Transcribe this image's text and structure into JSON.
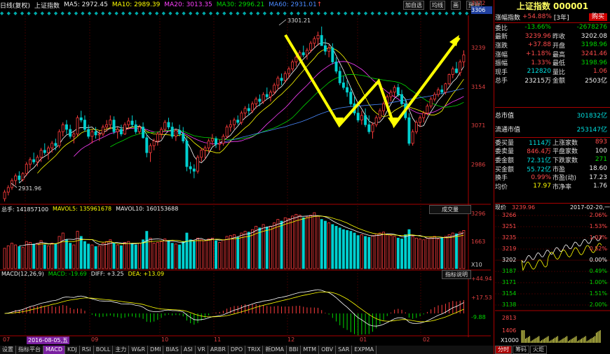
{
  "toolbar": {
    "period": "日线(复权)",
    "name": "上证指数",
    "ma5": "MA5: 2972.45",
    "ma10": "MA10: 2989.39",
    "ma20": "MA20: 3013.35",
    "ma30": "MA30: 2996.21",
    "ma60": "MA60: 2931.01",
    "btn_add": "加自选",
    "btn_ma": "均线",
    "btn_draw": "画",
    "btn_forecast": "预测"
  },
  "price_axis": [
    "3306",
    "3239",
    "3154",
    "3071",
    "2986"
  ],
  "price_axis_top": "3322",
  "annotations": {
    "high": "3301.21",
    "low": "2931.96"
  },
  "vol_bar": {
    "total": "总手: 141857100",
    "mavol5": "MAVOL5: 135961678",
    "mavol10": "MAVOL10: 160153688",
    "btn": "成交量",
    "axis_top": "3296",
    "axis_mid": "1663",
    "axis_unit": "X10"
  },
  "macd_bar": {
    "title": "MACD(12,26,9)",
    "macd": "MACD: -19.69",
    "diff": "DIFF: +3.25",
    "dea": "DEA: +13.09",
    "btn": "指标说明",
    "axis": [
      "+44.94",
      "+17.53",
      "-9.88"
    ]
  },
  "months": [
    "07",
    "08",
    "09",
    "10",
    "11",
    "12",
    "01",
    "02"
  ],
  "cursor_date": "2016-08-05,五",
  "bottom_tabs": [
    "设置",
    "指标平台",
    "MACD",
    "KDJ",
    "RSI",
    "BOLL",
    "主力",
    "W&R",
    "DMI",
    "BIAS",
    "ASI",
    "VR",
    "ARBR",
    "DPO",
    "TRIX",
    "新DMA",
    "BBI",
    "MTM",
    "OBV",
    "SAR",
    "EXPMA"
  ],
  "right": {
    "title": "上证指数 000001",
    "sub1": "涨幅指数",
    "sub2": "+54.88%",
    "sub3": "[3年]",
    "btn_buy": "购买",
    "rows": [
      [
        "委比",
        "-13.66%",
        "",
        "-2678276"
      ],
      [
        "最新",
        "3239.96",
        "昨收",
        "3202.08"
      ],
      [
        "涨跌",
        "+37.88",
        "开盘",
        "3198.96"
      ],
      [
        "涨幅",
        "+1.18%",
        "最高",
        "3241.46"
      ],
      [
        "振幅",
        "1.33%",
        "最低",
        "3198.96"
      ],
      [
        "现手",
        "212820",
        "量比",
        "1.06"
      ],
      [
        "总手",
        "23215万",
        "金额",
        "2503亿"
      ]
    ],
    "mktcap_k": "总市值",
    "mktcap_v": "301832亿",
    "float_k": "流通市值",
    "float_v": "253147亿",
    "rows2": [
      [
        "委买量",
        "1114万",
        "上涨家数",
        "893"
      ],
      [
        "委卖量",
        "846.4万",
        "平盘家数",
        "100"
      ],
      [
        "委金额",
        "72.31亿",
        "下跌家数",
        "271"
      ],
      [
        "买金额",
        "55.72亿",
        "市盈",
        "18.60"
      ],
      [
        "换手",
        "0.99%",
        "市盈(动)",
        "17.23"
      ],
      [
        "均价",
        "17.97",
        "市净率",
        "1.76"
      ]
    ],
    "intraday": {
      "label": "现价",
      "price": "3239.96",
      "date": "2017-02-20,一",
      "left_axis": [
        "3266",
        "3251",
        "3235",
        "3219",
        "3202",
        "3187",
        "3171",
        "3154",
        "3138"
      ],
      "right_axis": [
        "2.06%",
        "1.53%",
        "1.03%",
        "0.52%",
        "0.00%",
        "0.49%",
        "1.00%",
        "1.51%",
        "2.00%"
      ],
      "vol_axis": [
        "2813",
        "1406"
      ],
      "vol_unit": "X1000"
    },
    "tabs": [
      "分时",
      "筹码",
      "火炬"
    ]
  },
  "chart_data": {
    "type": "candlestick",
    "candles": [
      [
        2931,
        2950,
        2925,
        2945
      ],
      [
        2945,
        2960,
        2938,
        2955
      ],
      [
        2955,
        2975,
        2950,
        2970
      ],
      [
        2970,
        2985,
        2960,
        2980
      ],
      [
        2980,
        2990,
        2965,
        2972
      ],
      [
        2972,
        2988,
        2968,
        2985
      ],
      [
        2985,
        3010,
        2980,
        3005
      ],
      [
        3005,
        3020,
        2995,
        3015
      ],
      [
        3015,
        3030,
        3005,
        3010
      ],
      [
        3010,
        3025,
        3000,
        3020
      ],
      [
        3020,
        3040,
        3010,
        3035
      ],
      [
        3035,
        3050,
        3025,
        3030
      ],
      [
        3030,
        3045,
        3015,
        3040
      ],
      [
        3040,
        3055,
        3030,
        3050
      ],
      [
        3050,
        3060,
        3035,
        3045
      ],
      [
        3045,
        3080,
        3040,
        3075
      ],
      [
        3075,
        3095,
        3065,
        3090
      ],
      [
        3090,
        3100,
        3070,
        3080
      ],
      [
        3080,
        3090,
        3060,
        3065
      ],
      [
        3065,
        3075,
        3050,
        3070
      ],
      [
        3070,
        3110,
        3065,
        3105
      ],
      [
        3105,
        3120,
        3095,
        3100
      ],
      [
        3100,
        3110,
        3075,
        3080
      ],
      [
        3080,
        3090,
        3060,
        3065
      ],
      [
        3065,
        3080,
        3050,
        3075
      ],
      [
        3075,
        3085,
        3060,
        3068
      ],
      [
        3068,
        3078,
        3055,
        3070
      ],
      [
        3070,
        3090,
        3065,
        3085
      ],
      [
        3085,
        3100,
        3075,
        3090
      ],
      [
        3090,
        3110,
        3080,
        3100
      ],
      [
        3100,
        3108,
        3070,
        3075
      ],
      [
        3075,
        3085,
        3060,
        3080
      ],
      [
        3080,
        3090,
        3065,
        3070
      ],
      [
        3070,
        3095,
        3068,
        3090
      ],
      [
        3090,
        3105,
        3080,
        3098
      ],
      [
        3098,
        3110,
        3085,
        3090
      ],
      [
        3090,
        3100,
        3070,
        3075
      ],
      [
        3075,
        3090,
        3070,
        3085
      ],
      [
        3085,
        3095,
        3060,
        3062
      ],
      [
        3062,
        3070,
        3020,
        3030
      ],
      [
        3030,
        3050,
        3010,
        3045
      ],
      [
        3045,
        3060,
        3035,
        3055
      ],
      [
        3055,
        3075,
        3045,
        3070
      ],
      [
        3070,
        3085,
        3060,
        3080
      ],
      [
        3080,
        3100,
        3075,
        3095
      ],
      [
        3095,
        3105,
        3080,
        3085
      ],
      [
        3085,
        3095,
        3060,
        3065
      ],
      [
        3065,
        3080,
        3055,
        3078
      ],
      [
        3078,
        3090,
        3065,
        3070
      ],
      [
        3070,
        3085,
        3050,
        3055
      ],
      [
        3055,
        3065,
        2990,
        3000
      ],
      [
        3000,
        3010,
        2985,
        2995
      ],
      [
        2995,
        3005,
        2975,
        2990
      ],
      [
        2990,
        3025,
        2985,
        3020
      ],
      [
        3020,
        3040,
        3010,
        3035
      ],
      [
        3035,
        3045,
        3015,
        3040
      ],
      [
        3040,
        3060,
        3030,
        3055
      ],
      [
        3055,
        3070,
        3045,
        3060
      ],
      [
        3060,
        3065,
        3040,
        3048
      ],
      [
        3048,
        3058,
        3035,
        3050
      ],
      [
        3050,
        3070,
        3045,
        3065
      ],
      [
        3065,
        3090,
        3060,
        3085
      ],
      [
        3085,
        3100,
        3075,
        3090
      ],
      [
        3090,
        3105,
        3080,
        3100
      ],
      [
        3100,
        3110,
        3090,
        3095
      ],
      [
        3095,
        3120,
        3090,
        3115
      ],
      [
        3115,
        3130,
        3105,
        3125
      ],
      [
        3125,
        3135,
        3110,
        3120
      ],
      [
        3120,
        3140,
        3115,
        3135
      ],
      [
        3135,
        3150,
        3125,
        3145
      ],
      [
        3145,
        3155,
        3130,
        3140
      ],
      [
        3140,
        3160,
        3135,
        3155
      ],
      [
        3155,
        3170,
        3145,
        3150
      ],
      [
        3150,
        3165,
        3140,
        3160
      ],
      [
        3160,
        3180,
        3155,
        3175
      ],
      [
        3175,
        3195,
        3165,
        3190
      ],
      [
        3190,
        3200,
        3175,
        3185
      ],
      [
        3185,
        3205,
        3180,
        3200
      ],
      [
        3200,
        3215,
        3190,
        3210
      ],
      [
        3210,
        3230,
        3205,
        3225
      ],
      [
        3225,
        3240,
        3215,
        3235
      ],
      [
        3235,
        3250,
        3225,
        3245
      ],
      [
        3245,
        3260,
        3235,
        3240
      ],
      [
        3240,
        3255,
        3230,
        3250
      ],
      [
        3250,
        3270,
        3245,
        3265
      ],
      [
        3265,
        3280,
        3255,
        3275
      ],
      [
        3275,
        3290,
        3260,
        3282
      ],
      [
        3282,
        3301,
        3270,
        3260
      ],
      [
        3260,
        3275,
        3240,
        3248
      ],
      [
        3248,
        3262,
        3235,
        3255
      ],
      [
        3255,
        3265,
        3220,
        3225
      ],
      [
        3225,
        3235,
        3200,
        3205
      ],
      [
        3205,
        3215,
        3175,
        3180
      ],
      [
        3180,
        3195,
        3165,
        3170
      ],
      [
        3170,
        3185,
        3150,
        3160
      ],
      [
        3160,
        3170,
        3130,
        3135
      ],
      [
        3135,
        3150,
        3110,
        3115
      ],
      [
        3115,
        3130,
        3095,
        3100
      ],
      [
        3100,
        3120,
        3090,
        3110
      ],
      [
        3110,
        3125,
        3085,
        3090
      ],
      [
        3090,
        3110,
        3070,
        3075
      ],
      [
        3075,
        3095,
        3060,
        3090
      ],
      [
        3090,
        3110,
        3085,
        3105
      ],
      [
        3105,
        3125,
        3100,
        3120
      ],
      [
        3120,
        3140,
        3110,
        3135
      ],
      [
        3135,
        3155,
        3125,
        3150
      ],
      [
        3150,
        3165,
        3140,
        3160
      ],
      [
        3160,
        3175,
        3150,
        3170
      ],
      [
        3170,
        3178,
        3150,
        3155
      ],
      [
        3155,
        3165,
        3130,
        3135
      ],
      [
        3135,
        3145,
        3100,
        3105
      ],
      [
        3105,
        3115,
        3045,
        3050
      ],
      [
        3050,
        3080,
        3045,
        3075
      ],
      [
        3075,
        3100,
        3070,
        3095
      ],
      [
        3095,
        3110,
        3085,
        3105
      ],
      [
        3105,
        3120,
        3095,
        3115
      ],
      [
        3115,
        3135,
        3110,
        3130
      ],
      [
        3130,
        3150,
        3125,
        3145
      ],
      [
        3145,
        3160,
        3140,
        3155
      ],
      [
        3155,
        3170,
        3150,
        3165
      ],
      [
        3165,
        3175,
        3155,
        3160
      ],
      [
        3160,
        3180,
        3155,
        3178
      ],
      [
        3178,
        3200,
        3175,
        3198
      ],
      [
        3198,
        3215,
        3190,
        3210
      ],
      [
        3210,
        3225,
        3200,
        3202
      ],
      [
        3202,
        3230,
        3195,
        3225
      ],
      [
        3225,
        3250,
        3215,
        3240
      ]
    ],
    "volume": [
      1200,
      1350,
      1500,
      1400,
      1300,
      1250,
      1600,
      1550,
      1450,
      1500,
      1650,
      1400,
      1350,
      1500,
      1450,
      1900,
      2100,
      1700,
      1500,
      1400,
      2200,
      1900,
      1600,
      1450,
      1400,
      1300,
      1350,
      1500,
      1600,
      1700,
      1500,
      1400,
      1350,
      1550,
      1600,
      1450,
      1400,
      1500,
      1700,
      2200,
      1800,
      1500,
      1550,
      1600,
      1750,
      1650,
      1500,
      1450,
      1400,
      1600,
      2100,
      1700,
      1600,
      1800,
      1700,
      1650,
      1750,
      1800,
      1650,
      1550,
      1700,
      1900,
      1950,
      2000,
      1850,
      2100,
      2200,
      2150,
      2300,
      2500,
      2400,
      2600,
      2450,
      2500,
      2700,
      2900,
      2800,
      3000,
      2950,
      3100,
      3200,
      3150,
      3000,
      3050,
      3150,
      3296,
      3100,
      2900,
      2800,
      2700,
      2600,
      2500,
      2400,
      2300,
      2250,
      2200,
      2100,
      1950,
      2000,
      1900,
      1850,
      1950,
      2050,
      2100,
      2150,
      2000,
      1950,
      1900,
      1800,
      1750,
      2000,
      2300,
      1900,
      1800,
      1750,
      1700,
      1800,
      1850,
      1900,
      1750,
      1800,
      1900,
      2000,
      2100,
      2050,
      2150,
      2250
    ],
    "annotated_high": 3301.21,
    "annotated_low": 2931.96,
    "ylim": [
      2931,
      3322
    ]
  }
}
